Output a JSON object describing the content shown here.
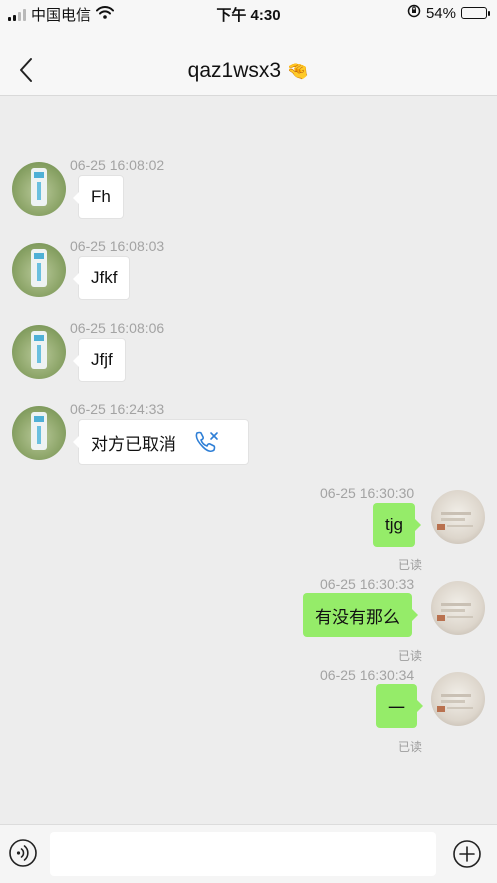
{
  "status_bar": {
    "carrier": "中国电信",
    "time": "下午 4:30",
    "battery": "54%",
    "battery_level": 0.54,
    "icons": [
      "signal-icon",
      "wifi-icon",
      "rotation-lock-icon",
      "battery-icon"
    ]
  },
  "header": {
    "title": "qaz1wsx3",
    "title_emoji": "🤏",
    "back_icon": "back-chevron-icon"
  },
  "messages": [
    {
      "time": "06-25 16:08:02",
      "text": "Fh",
      "direction": "incoming"
    },
    {
      "time": "06-25 16:08:03",
      "text": "Jfkf",
      "direction": "incoming"
    },
    {
      "time": "06-25 16:08:06",
      "text": "Jfjf",
      "direction": "incoming"
    },
    {
      "time": "06-25 16:24:33",
      "text": "对方已取消",
      "direction": "incoming",
      "icon": "call-cancelled-icon"
    },
    {
      "time": "06-25 16:30:30",
      "text": "tjg",
      "direction": "outgoing",
      "status": "已读"
    },
    {
      "time": "06-25 16:30:33",
      "text": "有没有那么",
      "direction": "outgoing",
      "status": "已读"
    },
    {
      "time": "06-25 16:30:34",
      "text": "一",
      "direction": "outgoing",
      "status": "已读"
    }
  ],
  "input_bar": {
    "placeholder": "",
    "value": "",
    "left_icon": "voice-icon",
    "right_icon": "plus-icon"
  },
  "colors": {
    "outgoing_bubble": "#95ec69",
    "incoming_bubble": "#ffffff",
    "background": "#ededed",
    "call_icon": "#2f7fd6"
  }
}
